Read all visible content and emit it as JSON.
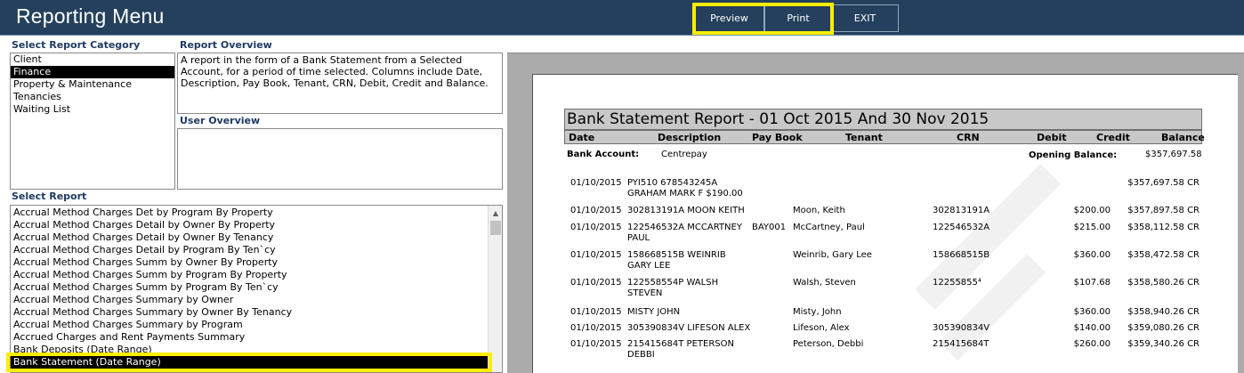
{
  "header": {
    "title": "Reporting Menu",
    "preview_label": "Preview",
    "print_label": "Print",
    "exit_label": "EXIT",
    "highlight_color": "#ffed00"
  },
  "category": {
    "label": "Select Report Category",
    "items": [
      "Client",
      "Finance",
      "Property & Maintenance",
      "Tenancies",
      "Waiting List"
    ],
    "selected": "Finance"
  },
  "overview": {
    "label": "Report Overview",
    "text": "A report in the form of a Bank Statement from a Selected Account, for a period of time selected. Columns include Date, Description, Pay Book, Tenant, CRN, Debit, Credit and Balance."
  },
  "user_overview": {
    "label": "User Overview",
    "text": ""
  },
  "reports": {
    "label": "Select Report",
    "items": [
      "Accrual Method Charges Det by Program By Property",
      "Accrual Method Charges Detail by Owner By Property",
      "Accrual Method Charges Detail by Owner By Tenancy",
      "Accrual Method Charges Detail by Program By Ten`cy",
      "Accrual Method Charges Summ by Owner By Property",
      "Accrual Method Charges Summ by Program By Property",
      "Accrual Method Charges Summ by Program By Ten`cy",
      "Accrual Method Charges Summary by Owner",
      "Accrual Method Charges Summary by Owner By Tenancy",
      "Accrual Method Charges Summary by Program",
      "Accrued Charges and Rent Payments  Summary",
      "Bank Deposits (Date Range)",
      "Bank Statement (Date Range)"
    ],
    "selected": "Bank Statement (Date Range)"
  },
  "report": {
    "title": "Bank Statement Report - 01 Oct 2015 And 30 Nov 2015",
    "columns": [
      "Date",
      "Description",
      "Pay Book",
      "Tenant",
      "CRN",
      "Debit",
      "Credit",
      "Balance"
    ],
    "bank_account_label": "Bank Account:",
    "bank_account_value": "Centrepay",
    "opening_balance_label": "Opening Balance:",
    "opening_balance_value": "$357,697.58",
    "rows": [
      {
        "date": "01/10/2015",
        "desc1": "PYI510 678543245A",
        "desc2": "GRAHAM MARK F $190.00",
        "paybook": "",
        "tenant": "",
        "crn": "",
        "debit": "",
        "credit": "",
        "balance": "$357,697.58 CR"
      },
      {
        "date": "01/10/2015",
        "desc1": "302813191A MOON KEITH",
        "desc2": "",
        "paybook": "",
        "tenant": "Moon, Keith",
        "crn": "302813191A",
        "debit": "",
        "credit": "$200.00",
        "balance": "$357,897.58 CR"
      },
      {
        "date": "01/10/2015",
        "desc1": "122546532A MCCARTNEY",
        "desc2": "PAUL",
        "paybook": "BAY001",
        "tenant": "McCartney, Paul",
        "crn": "122546532A",
        "debit": "",
        "credit": "$215.00",
        "balance": "$358,112.58 CR"
      },
      {
        "date": "01/10/2015",
        "desc1": "158668515B WEINRIB",
        "desc2": "GARY LEE",
        "paybook": "",
        "tenant": "Weinrib, Gary Lee",
        "crn": "158668515B",
        "debit": "",
        "credit": "$360.00",
        "balance": "$358,472.58 CR"
      },
      {
        "date": "01/10/2015",
        "desc1": "122558554P WALSH",
        "desc2": "STEVEN",
        "paybook": "",
        "tenant": "Walsh, Steven",
        "crn": "12255855⁴",
        "debit": "",
        "credit": "$107.68",
        "balance": "$358,580.26 CR"
      },
      {
        "date": "01/10/2015",
        "desc1": " MISTY JOHN",
        "desc2": "",
        "paybook": "",
        "tenant": "Misty, John",
        "crn": "",
        "debit": "",
        "credit": "$360.00",
        "balance": "$358,940.26 CR"
      },
      {
        "date": "01/10/2015",
        "desc1": "305390834V LIFESON ALEX",
        "desc2": "",
        "paybook": "",
        "tenant": "Lifeson, Alex",
        "crn": "305390834V",
        "debit": "",
        "credit": "$140.00",
        "balance": "$359,080.26 CR"
      },
      {
        "date": "01/10/2015",
        "desc1": "215415684T PETERSON",
        "desc2": "DEBBI",
        "paybook": "",
        "tenant": "Peterson, Debbi",
        "crn": "215415684T",
        "debit": "",
        "credit": "$260.00",
        "balance": "$359,340.26 CR"
      }
    ]
  },
  "icons": {
    "scroll_up": "chevron-up-icon"
  }
}
